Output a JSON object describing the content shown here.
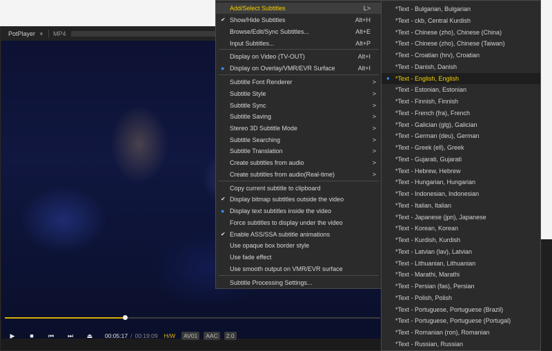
{
  "player": {
    "app_name": "PotPlayer",
    "format": "MP4",
    "progress": 0.32,
    "current_time": "00:05:17",
    "separator": "/",
    "total_time": "00:19:09",
    "tags": [
      "H/W",
      "AV01",
      "AAC",
      "2.0"
    ]
  },
  "icons": {
    "play": "play-icon",
    "stop": "stop-icon",
    "prev": "previous-icon",
    "next": "next-icon",
    "eject": "eject-icon"
  },
  "colors": {
    "accent": "#f5d000",
    "radio": "#3d8bff",
    "progress": "#d8b000"
  },
  "main_menu": {
    "items": [
      {
        "label": "Add/Select Subtitles",
        "shortcut": "L>",
        "highlight": true
      },
      {
        "label": "Show/Hide Subtitles",
        "shortcut": "Alt+H",
        "mark": "check"
      },
      {
        "label": "Browse/Edit/Sync Subtitles...",
        "shortcut": "Alt+E"
      },
      {
        "label": "Input Subtitles...",
        "shortcut": "Alt+P"
      },
      {
        "label": "Display on Video (TV-OUT)",
        "shortcut": "Alt+I"
      },
      {
        "label": "Display on Overlay/VMR/EVR Surface",
        "shortcut": "Alt+I",
        "mark": "dot"
      },
      {
        "label": "Subtitle Font Renderer",
        "arrow": ">"
      },
      {
        "label": "Subtitle Style",
        "arrow": ">"
      },
      {
        "label": "Subtitle Sync",
        "arrow": ">"
      },
      {
        "label": "Subtitle Saving",
        "arrow": ">"
      },
      {
        "label": "Stereo 3D Subtitle Mode",
        "arrow": ">"
      },
      {
        "label": "Subtitle Searching",
        "arrow": ">"
      },
      {
        "label": "Subtitle Translation",
        "arrow": ">"
      },
      {
        "label": "Create subtitles from audio",
        "arrow": ">"
      },
      {
        "label": "Create subtitles from audio(Real-time)",
        "arrow": ">"
      },
      {
        "label": "Copy current subtitle to clipboard"
      },
      {
        "label": "Display bitmap subtitles outside the video",
        "mark": "check"
      },
      {
        "label": "Display text subtitles inside the video",
        "mark": "dot"
      },
      {
        "label": "Force subtitles to display under the video"
      },
      {
        "label": "Enable ASS/SSA subtitle animations",
        "mark": "check"
      },
      {
        "label": "Use opaque box border style"
      },
      {
        "label": "Use fade effect"
      },
      {
        "label": "Use smooth output on VMR/EVR surface"
      },
      {
        "label": "Subtitle Processing Settings..."
      }
    ]
  },
  "subtitle_menu": {
    "items": [
      {
        "label": "*Text - Bulgarian, Bulgarian"
      },
      {
        "label": "*Text - ckb, Central Kurdish"
      },
      {
        "label": "*Text - Chinese (zho), Chinese (China)"
      },
      {
        "label": "*Text - Chinese (zho), Chinese (Taiwan)"
      },
      {
        "label": "*Text - Croatian (hrv), Croatian"
      },
      {
        "label": "*Text - Danish, Danish"
      },
      {
        "label": "*Text - English, English",
        "selected": true
      },
      {
        "label": "*Text - Estonian, Estonian"
      },
      {
        "label": "*Text - Finnish, Finnish"
      },
      {
        "label": "*Text - French (fra), French"
      },
      {
        "label": "*Text - Galician (glg), Galician"
      },
      {
        "label": "*Text - German (deu), German"
      },
      {
        "label": "*Text - Greek (ell), Greek"
      },
      {
        "label": "*Text - Gujarati, Gujarati"
      },
      {
        "label": "*Text - Hebrew, Hebrew"
      },
      {
        "label": "*Text - Hungarian, Hungarian"
      },
      {
        "label": "*Text - Indonesian, Indonesian"
      },
      {
        "label": "*Text - Italian, Italian"
      },
      {
        "label": "*Text - Japanese (jpn), Japanese"
      },
      {
        "label": "*Text - Korean, Korean"
      },
      {
        "label": "*Text - Kurdish, Kurdish"
      },
      {
        "label": "*Text - Latvian (lav), Latvian"
      },
      {
        "label": "*Text - Lithuanian, Lithuanian"
      },
      {
        "label": "*Text - Marathi, Marathi"
      },
      {
        "label": "*Text - Persian (fas), Persian"
      },
      {
        "label": "*Text - Polish, Polish"
      },
      {
        "label": "*Text - Portuguese, Portuguese (Brazil)"
      },
      {
        "label": "*Text - Portuguese, Portuguese (Portugal)"
      },
      {
        "label": "*Text - Romanian (ron), Romanian"
      },
      {
        "label": "*Text - Russian, Russian"
      }
    ]
  }
}
